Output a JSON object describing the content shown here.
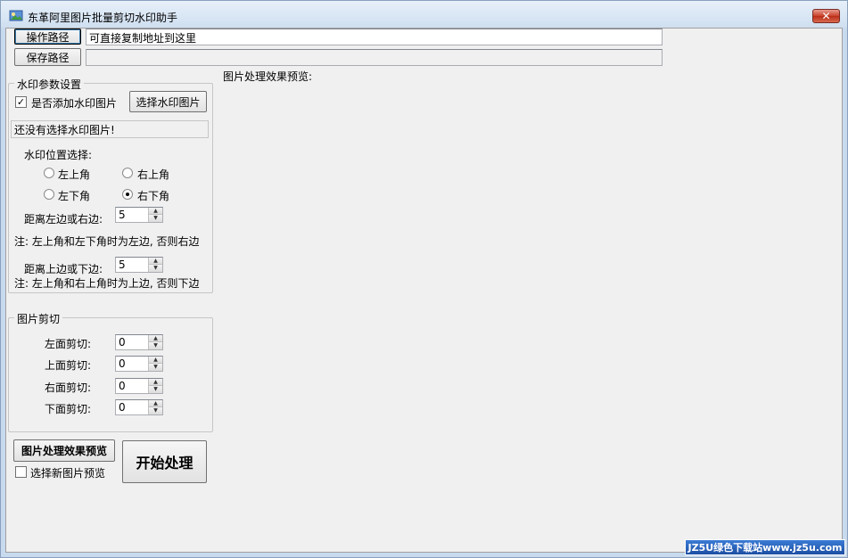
{
  "window": {
    "title": "东革阿里图片批量剪切水印助手",
    "close_label": "✕"
  },
  "paths": {
    "operate_button": "操作路径",
    "operate_value": "可直接复制地址到这里",
    "save_button": "保存路径",
    "save_value": ""
  },
  "preview_label": "图片处理效果预览:",
  "watermark": {
    "group_title": "水印参数设置",
    "add_checkbox_label": "是否添加水印图片",
    "add_checked": true,
    "select_button": "选择水印图片",
    "status_text": "还没有选择水印图片!",
    "position_label": "水印位置选择:",
    "positions": [
      {
        "label": "左上角",
        "selected": false
      },
      {
        "label": "右上角",
        "selected": false
      },
      {
        "label": "左下角",
        "selected": false
      },
      {
        "label": "右下角",
        "selected": true
      }
    ],
    "horizontal_label": "距离左边或右边:",
    "horizontal_value": "5",
    "horizontal_note": "注: 左上角和左下角时为左边, 否则右边",
    "vertical_label": "距离上边或下边:",
    "vertical_value": "5",
    "vertical_note": "注: 左上角和右上角时为上边, 否则下边"
  },
  "crop": {
    "group_title": "图片剪切",
    "left_label": "左面剪切:",
    "left_value": "0",
    "top_label": "上面剪切:",
    "top_value": "0",
    "right_label": "右面剪切:",
    "right_value": "0",
    "bottom_label": "下面剪切:",
    "bottom_value": "0"
  },
  "actions": {
    "preview_button": "图片处理效果预览",
    "new_preview_checkbox_label": "选择新图片预览",
    "new_preview_checked": false,
    "start_button": "开始处理"
  },
  "badge": {
    "text": "JZ5U绿色下载站www.jz5u.com"
  },
  "colors": {
    "titlebar": "#cfdff0",
    "close_button": "#c9412b",
    "client_bg": "#f0f0f0"
  }
}
